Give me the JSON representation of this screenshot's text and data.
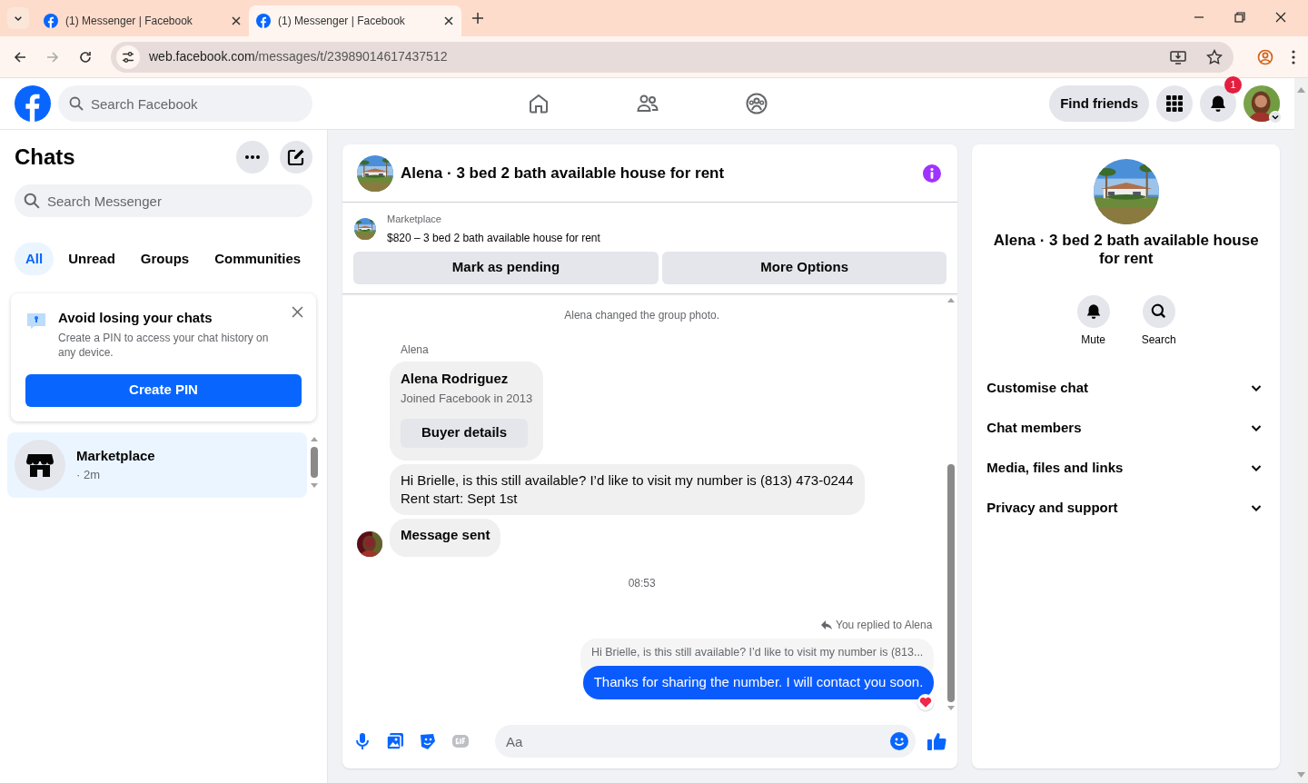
{
  "browser": {
    "tabs": [
      {
        "title": "(1) Messenger | Facebook",
        "selected": false
      },
      {
        "title": "(1) Messenger | Facebook",
        "selected": true
      }
    ],
    "url": {
      "host": "web.facebook.com",
      "path": "/messages/t/23989014617437512"
    }
  },
  "top_bar": {
    "search_placeholder": "Search Facebook",
    "find_friends": "Find friends",
    "notification_count": "1"
  },
  "chats": {
    "title": "Chats",
    "search_placeholder": "Search Messenger",
    "filters": [
      {
        "label": "All",
        "selected": true
      },
      {
        "label": "Unread",
        "selected": false
      },
      {
        "label": "Groups",
        "selected": false
      },
      {
        "label": "Communities",
        "selected": false
      }
    ],
    "pin_prompt": {
      "title": "Avoid losing your chats",
      "text": "Create a PIN to access your chat history on any device.",
      "button": "Create PIN"
    },
    "conversations": [
      {
        "name": "Marketplace",
        "time": "· 2m",
        "selected": true
      }
    ]
  },
  "conversation": {
    "title": "Alena · 3 bed 2 bath available house for rent",
    "listing": {
      "label": "Marketplace",
      "title": "$820 – 3 bed 2 bath available house for rent"
    },
    "actions": [
      "Mark as pending",
      "More Options"
    ],
    "messages": [
      {
        "kind": "system",
        "text": "Alena changed the group photo."
      },
      {
        "kind": "sender",
        "text": "Alena"
      },
      {
        "kind": "card",
        "title": "Alena Rodriguez",
        "subtitle": "Joined Facebook in 2013",
        "button": "Buyer details"
      },
      {
        "kind": "incoming",
        "text": "Hi Brielle, is this still available? I’d like to visit my number is (813) 473-0244\nRent start: Sept 1st",
        "bold": false,
        "avatar": false
      },
      {
        "kind": "incoming",
        "text": "Message sent",
        "bold": true,
        "avatar": true
      },
      {
        "kind": "time",
        "text": "08:53"
      },
      {
        "kind": "reply_label",
        "text": "You replied to Alena"
      },
      {
        "kind": "quoted",
        "text": "Hi Brielle, is this still available? I’d like to visit my number is (813..."
      },
      {
        "kind": "outgoing",
        "text": "Thanks for sharing the number. I will contact you soon.",
        "reacted": true
      }
    ],
    "composer": {
      "placeholder": "Aa"
    }
  },
  "details": {
    "title": "Alena · 3 bed 2 bath available house for rent",
    "actions": [
      {
        "kind": "mute",
        "label": "Mute"
      },
      {
        "kind": "search",
        "label": "Search"
      }
    ],
    "sections": [
      {
        "label": "Customise chat",
        "expanded": false
      },
      {
        "label": "Chat members",
        "expanded": false
      },
      {
        "label": "Media, files and links",
        "expanded": false
      },
      {
        "label": "Privacy and support",
        "expanded": false
      }
    ]
  }
}
